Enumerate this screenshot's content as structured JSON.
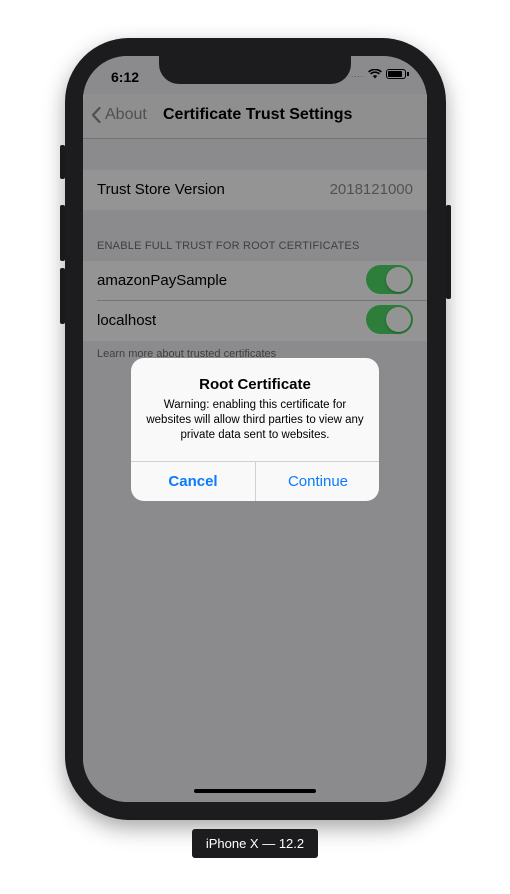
{
  "status_bar": {
    "time": "6:12",
    "signal": "....",
    "wifi_icon": "wifi-icon",
    "battery_icon": "battery-icon"
  },
  "navbar": {
    "back_label": "About",
    "back_icon": "chevron-left-icon",
    "title": "Certificate Trust Settings"
  },
  "trust_store": {
    "label": "Trust Store Version",
    "value": "2018121000"
  },
  "section": {
    "header": "ENABLE FULL TRUST FOR ROOT CERTIFICATES",
    "items": [
      {
        "label": "amazonPaySample",
        "enabled": true
      },
      {
        "label": "localhost",
        "enabled": true
      }
    ],
    "footer": "Learn more about trusted certificates"
  },
  "alert": {
    "title": "Root Certificate",
    "message": "Warning: enabling this certificate for websites will allow third parties to view any private data sent to websites.",
    "cancel_label": "Cancel",
    "continue_label": "Continue"
  },
  "device_label": "iPhone X — 12.2",
  "colors": {
    "accent": "#0a7aff",
    "toggle_on": "#4cd964"
  }
}
